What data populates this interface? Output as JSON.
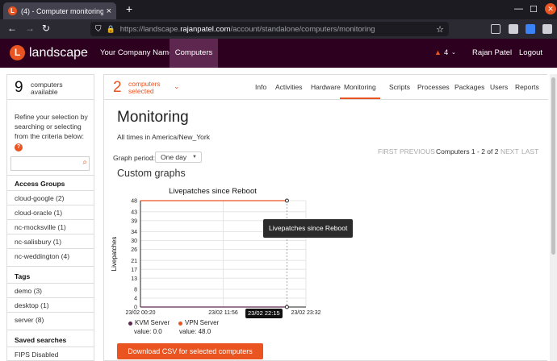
{
  "browser": {
    "tab_title": "(4) - Computer monitoring",
    "tab_favicon": "L",
    "url_prefix": "https://landscape.",
    "url_domain": "rajanpatel.com",
    "url_path": "/account/standalone/computers/monitoring",
    "new_tab": "+",
    "close_tab": "×"
  },
  "app": {
    "logo_letter": "L",
    "logo_text": "landscape",
    "company": "Your Company Name",
    "computers_nav": "Computers",
    "alert_count": "4",
    "user": "Rajan Patel",
    "logout": "Logout",
    "brand_color": "#e95420",
    "header_bg": "#2c001e"
  },
  "sidebar": {
    "available_count": "9",
    "available_label_1": "computers",
    "available_label_2": "available",
    "help_text": "Refine your selection by searching or selecting from the criteria below:",
    "help_icon": "?",
    "search_placeholder": "",
    "access_groups_title": "Access Groups",
    "access_groups": [
      "cloud-google (2)",
      "cloud-oracle (1)",
      "nc-mocksville (1)",
      "nc-salisbury (1)",
      "nc-weddington (4)"
    ],
    "tags_title": "Tags",
    "tags": [
      "demo (3)",
      "desktop (1)",
      "server (8)"
    ],
    "saved_searches_title": "Saved searches",
    "saved_searches": [
      "FIPS Disabled"
    ]
  },
  "main": {
    "selected_count": "2",
    "selected_label_1": "computers",
    "selected_label_2": "selected",
    "tabs": [
      "Info",
      "Activities",
      "Hardware",
      "Monitoring",
      "Scripts",
      "Processes",
      "Packages",
      "Users",
      "Reports"
    ],
    "active_tab": "Monitoring",
    "title": "Monitoring",
    "timezone_note": "All times in America/New_York",
    "graph_period_label": "Graph period:",
    "graph_period_value": "One day",
    "pager": {
      "first": "FIRST",
      "previous": "PREVIOUS",
      "current": "Computers 1 - 2 of 2",
      "next": "NEXT",
      "last": "LAST"
    },
    "custom_graphs_title": "Custom graphs",
    "tooltip": "Livepatches since Reboot",
    "hover_x_label": "23/02 22:15",
    "csv_button": "Download CSV for selected computers"
  },
  "chart_data": {
    "type": "line",
    "title": "Livepatches since Reboot",
    "xlabel": "",
    "ylabel": "Livepatches",
    "ylim": [
      0,
      48
    ],
    "yticks": [
      0,
      4,
      8,
      13,
      17,
      21,
      26,
      30,
      34,
      39,
      43,
      48
    ],
    "xticks": [
      "23/02 00:20",
      "23/02 11:56",
      "23/02 23:32"
    ],
    "series": [
      {
        "name": "KVM Server",
        "color": "#5e2750",
        "value_label": "value: 0.0",
        "points": [
          [
            0,
            0
          ],
          [
            1,
            0
          ],
          [
            1.77,
            0
          ]
        ]
      },
      {
        "name": "VPN Server",
        "color": "#e95420",
        "value_label": "value: 48.0",
        "points": [
          [
            0,
            48
          ],
          [
            1,
            48
          ],
          [
            1.77,
            48
          ]
        ]
      }
    ],
    "hover_index": 1.77,
    "grid": true
  }
}
